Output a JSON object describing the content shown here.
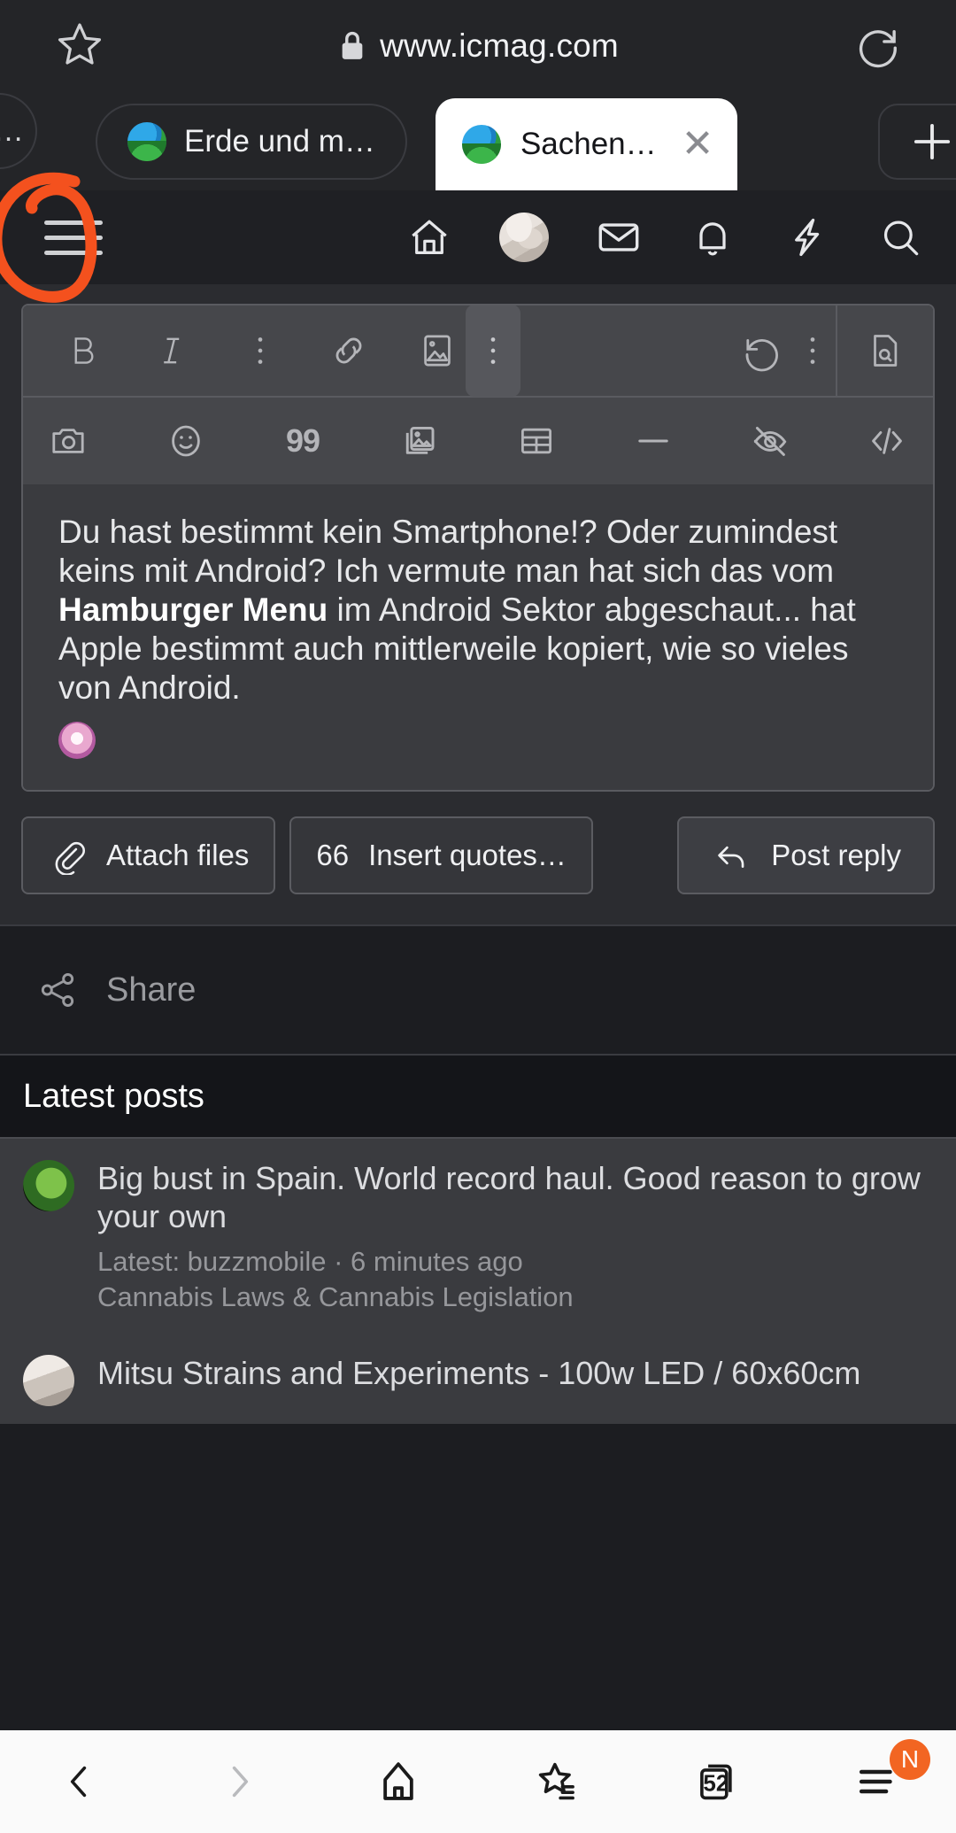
{
  "browser": {
    "url": "www.icmag.com",
    "lock_icon": "lock-icon",
    "bookmark_icon": "star-outline-icon",
    "reload_icon": "reload-icon",
    "tabs": [
      {
        "label": "…",
        "favicon": "globe-plant-icon",
        "active": false
      },
      {
        "label": "Erde und m…",
        "favicon": "globe-plant-icon",
        "active": false
      },
      {
        "label": "Sachen…",
        "favicon": "globe-plant-icon",
        "active": true,
        "close_label": "✕"
      }
    ],
    "new_tab_label": "+"
  },
  "forum_header": {
    "menu_icon": "hamburger-menu-icon",
    "icons": [
      {
        "name": "home-icon"
      },
      {
        "name": "user-avatar"
      },
      {
        "name": "inbox-envelope-icon"
      },
      {
        "name": "alerts-bell-icon"
      },
      {
        "name": "whats-new-lightning-icon"
      },
      {
        "name": "search-icon"
      }
    ]
  },
  "annotation": {
    "shape": "hand-drawn-circle",
    "color": "#f4511e",
    "target": "hamburger-menu-icon"
  },
  "editor": {
    "toolbar_row1": [
      {
        "name": "bold-icon",
        "label": "B"
      },
      {
        "name": "italic-icon",
        "label": "I"
      },
      {
        "name": "more-options-icon",
        "label": "⋮"
      },
      {
        "name": "link-icon",
        "label": ""
      },
      {
        "name": "insert-image-icon",
        "label": ""
      },
      {
        "name": "overflow-kebab-icon",
        "label": "⋮"
      }
    ],
    "toolbar_row1_right": [
      {
        "name": "undo-icon"
      },
      {
        "name": "undo-overflow-kebab-icon"
      },
      {
        "name": "draft-preview-icon"
      }
    ],
    "toolbar_row2": [
      {
        "name": "camera-icon"
      },
      {
        "name": "emoji-smiley-icon"
      },
      {
        "name": "quote-99-icon",
        "label": "99"
      },
      {
        "name": "gallery-icon"
      },
      {
        "name": "table-icon"
      },
      {
        "name": "horizontal-rule-icon"
      },
      {
        "name": "spoiler-eye-off-icon"
      },
      {
        "name": "code-icon"
      }
    ],
    "post_text_part1": "Du hast bestimmt kein Smartphone!? Oder zumindest keins mit Android? Ich vermute man hat sich das vom ",
    "post_text_bold": "Hamburger Menu",
    "post_text_part2": " im Android Sektor abgeschaut... hat Apple bestimmt auch mittlerweile kopiert, wie so vieles von Android.",
    "emoji_name": "sparkle-face-emoji"
  },
  "actions": {
    "attach_label": "Attach files",
    "attach_icon": "paperclip-icon",
    "quote_count": "66",
    "quote_label": "Insert quotes…",
    "post_label": "Post reply",
    "post_icon": "reply-arrow-icon"
  },
  "share": {
    "label": "Share",
    "icon": "share-nodes-icon"
  },
  "latest_posts": {
    "heading": "Latest posts",
    "items": [
      {
        "title": "Big bust in Spain. World record haul. Good reason to grow your own",
        "meta": "Latest: buzzmobile · 6 minutes ago",
        "forum": "Cannabis Laws & Cannabis Legislation",
        "avatar": "user-avatar-green"
      },
      {
        "title": "Mitsu Strains and Experiments - 100w LED / 60x60cm",
        "meta": "",
        "forum": "",
        "avatar": "user-avatar-pale"
      }
    ]
  },
  "bottom_nav": {
    "items": [
      {
        "name": "back-icon",
        "label": ""
      },
      {
        "name": "forward-icon",
        "label": ""
      },
      {
        "name": "home-icon",
        "label": ""
      },
      {
        "name": "bookmarks-star-icon",
        "label": ""
      },
      {
        "name": "tabs-icon",
        "label": "52"
      },
      {
        "name": "menu-icon",
        "label": ""
      }
    ],
    "badge": "N",
    "badge_color": "#f26522"
  }
}
